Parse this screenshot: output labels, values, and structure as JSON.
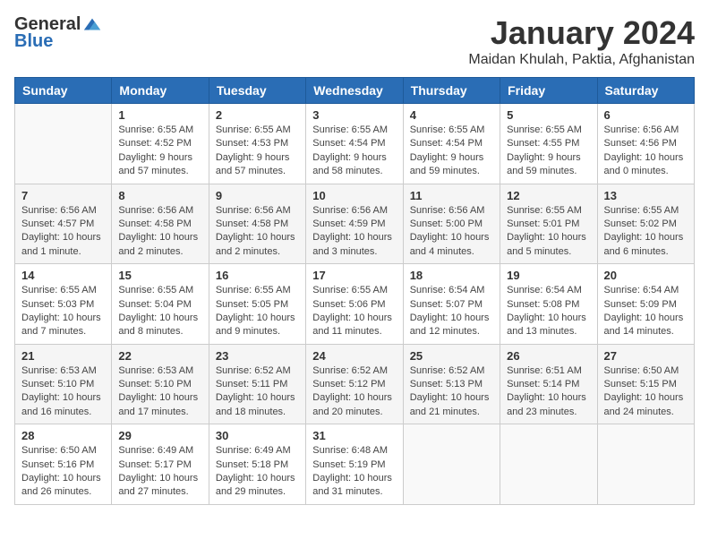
{
  "logo": {
    "general": "General",
    "blue": "Blue"
  },
  "title": "January 2024",
  "location": "Maidan Khulah, Paktia, Afghanistan",
  "days_of_week": [
    "Sunday",
    "Monday",
    "Tuesday",
    "Wednesday",
    "Thursday",
    "Friday",
    "Saturday"
  ],
  "weeks": [
    [
      {
        "day": "",
        "sunrise": "",
        "sunset": "",
        "daylight": "",
        "empty": true
      },
      {
        "day": "1",
        "sunrise": "Sunrise: 6:55 AM",
        "sunset": "Sunset: 4:52 PM",
        "daylight": "Daylight: 9 hours and 57 minutes.",
        "empty": false
      },
      {
        "day": "2",
        "sunrise": "Sunrise: 6:55 AM",
        "sunset": "Sunset: 4:53 PM",
        "daylight": "Daylight: 9 hours and 57 minutes.",
        "empty": false
      },
      {
        "day": "3",
        "sunrise": "Sunrise: 6:55 AM",
        "sunset": "Sunset: 4:54 PM",
        "daylight": "Daylight: 9 hours and 58 minutes.",
        "empty": false
      },
      {
        "day": "4",
        "sunrise": "Sunrise: 6:55 AM",
        "sunset": "Sunset: 4:54 PM",
        "daylight": "Daylight: 9 hours and 59 minutes.",
        "empty": false
      },
      {
        "day": "5",
        "sunrise": "Sunrise: 6:55 AM",
        "sunset": "Sunset: 4:55 PM",
        "daylight": "Daylight: 9 hours and 59 minutes.",
        "empty": false
      },
      {
        "day": "6",
        "sunrise": "Sunrise: 6:56 AM",
        "sunset": "Sunset: 4:56 PM",
        "daylight": "Daylight: 10 hours and 0 minutes.",
        "empty": false
      }
    ],
    [
      {
        "day": "7",
        "sunrise": "Sunrise: 6:56 AM",
        "sunset": "Sunset: 4:57 PM",
        "daylight": "Daylight: 10 hours and 1 minute.",
        "empty": false
      },
      {
        "day": "8",
        "sunrise": "Sunrise: 6:56 AM",
        "sunset": "Sunset: 4:58 PM",
        "daylight": "Daylight: 10 hours and 2 minutes.",
        "empty": false
      },
      {
        "day": "9",
        "sunrise": "Sunrise: 6:56 AM",
        "sunset": "Sunset: 4:58 PM",
        "daylight": "Daylight: 10 hours and 2 minutes.",
        "empty": false
      },
      {
        "day": "10",
        "sunrise": "Sunrise: 6:56 AM",
        "sunset": "Sunset: 4:59 PM",
        "daylight": "Daylight: 10 hours and 3 minutes.",
        "empty": false
      },
      {
        "day": "11",
        "sunrise": "Sunrise: 6:56 AM",
        "sunset": "Sunset: 5:00 PM",
        "daylight": "Daylight: 10 hours and 4 minutes.",
        "empty": false
      },
      {
        "day": "12",
        "sunrise": "Sunrise: 6:55 AM",
        "sunset": "Sunset: 5:01 PM",
        "daylight": "Daylight: 10 hours and 5 minutes.",
        "empty": false
      },
      {
        "day": "13",
        "sunrise": "Sunrise: 6:55 AM",
        "sunset": "Sunset: 5:02 PM",
        "daylight": "Daylight: 10 hours and 6 minutes.",
        "empty": false
      }
    ],
    [
      {
        "day": "14",
        "sunrise": "Sunrise: 6:55 AM",
        "sunset": "Sunset: 5:03 PM",
        "daylight": "Daylight: 10 hours and 7 minutes.",
        "empty": false
      },
      {
        "day": "15",
        "sunrise": "Sunrise: 6:55 AM",
        "sunset": "Sunset: 5:04 PM",
        "daylight": "Daylight: 10 hours and 8 minutes.",
        "empty": false
      },
      {
        "day": "16",
        "sunrise": "Sunrise: 6:55 AM",
        "sunset": "Sunset: 5:05 PM",
        "daylight": "Daylight: 10 hours and 9 minutes.",
        "empty": false
      },
      {
        "day": "17",
        "sunrise": "Sunrise: 6:55 AM",
        "sunset": "Sunset: 5:06 PM",
        "daylight": "Daylight: 10 hours and 11 minutes.",
        "empty": false
      },
      {
        "day": "18",
        "sunrise": "Sunrise: 6:54 AM",
        "sunset": "Sunset: 5:07 PM",
        "daylight": "Daylight: 10 hours and 12 minutes.",
        "empty": false
      },
      {
        "day": "19",
        "sunrise": "Sunrise: 6:54 AM",
        "sunset": "Sunset: 5:08 PM",
        "daylight": "Daylight: 10 hours and 13 minutes.",
        "empty": false
      },
      {
        "day": "20",
        "sunrise": "Sunrise: 6:54 AM",
        "sunset": "Sunset: 5:09 PM",
        "daylight": "Daylight: 10 hours and 14 minutes.",
        "empty": false
      }
    ],
    [
      {
        "day": "21",
        "sunrise": "Sunrise: 6:53 AM",
        "sunset": "Sunset: 5:10 PM",
        "daylight": "Daylight: 10 hours and 16 minutes.",
        "empty": false
      },
      {
        "day": "22",
        "sunrise": "Sunrise: 6:53 AM",
        "sunset": "Sunset: 5:10 PM",
        "daylight": "Daylight: 10 hours and 17 minutes.",
        "empty": false
      },
      {
        "day": "23",
        "sunrise": "Sunrise: 6:52 AM",
        "sunset": "Sunset: 5:11 PM",
        "daylight": "Daylight: 10 hours and 18 minutes.",
        "empty": false
      },
      {
        "day": "24",
        "sunrise": "Sunrise: 6:52 AM",
        "sunset": "Sunset: 5:12 PM",
        "daylight": "Daylight: 10 hours and 20 minutes.",
        "empty": false
      },
      {
        "day": "25",
        "sunrise": "Sunrise: 6:52 AM",
        "sunset": "Sunset: 5:13 PM",
        "daylight": "Daylight: 10 hours and 21 minutes.",
        "empty": false
      },
      {
        "day": "26",
        "sunrise": "Sunrise: 6:51 AM",
        "sunset": "Sunset: 5:14 PM",
        "daylight": "Daylight: 10 hours and 23 minutes.",
        "empty": false
      },
      {
        "day": "27",
        "sunrise": "Sunrise: 6:50 AM",
        "sunset": "Sunset: 5:15 PM",
        "daylight": "Daylight: 10 hours and 24 minutes.",
        "empty": false
      }
    ],
    [
      {
        "day": "28",
        "sunrise": "Sunrise: 6:50 AM",
        "sunset": "Sunset: 5:16 PM",
        "daylight": "Daylight: 10 hours and 26 minutes.",
        "empty": false
      },
      {
        "day": "29",
        "sunrise": "Sunrise: 6:49 AM",
        "sunset": "Sunset: 5:17 PM",
        "daylight": "Daylight: 10 hours and 27 minutes.",
        "empty": false
      },
      {
        "day": "30",
        "sunrise": "Sunrise: 6:49 AM",
        "sunset": "Sunset: 5:18 PM",
        "daylight": "Daylight: 10 hours and 29 minutes.",
        "empty": false
      },
      {
        "day": "31",
        "sunrise": "Sunrise: 6:48 AM",
        "sunset": "Sunset: 5:19 PM",
        "daylight": "Daylight: 10 hours and 31 minutes.",
        "empty": false
      },
      {
        "day": "",
        "sunrise": "",
        "sunset": "",
        "daylight": "",
        "empty": true
      },
      {
        "day": "",
        "sunrise": "",
        "sunset": "",
        "daylight": "",
        "empty": true
      },
      {
        "day": "",
        "sunrise": "",
        "sunset": "",
        "daylight": "",
        "empty": true
      }
    ]
  ]
}
